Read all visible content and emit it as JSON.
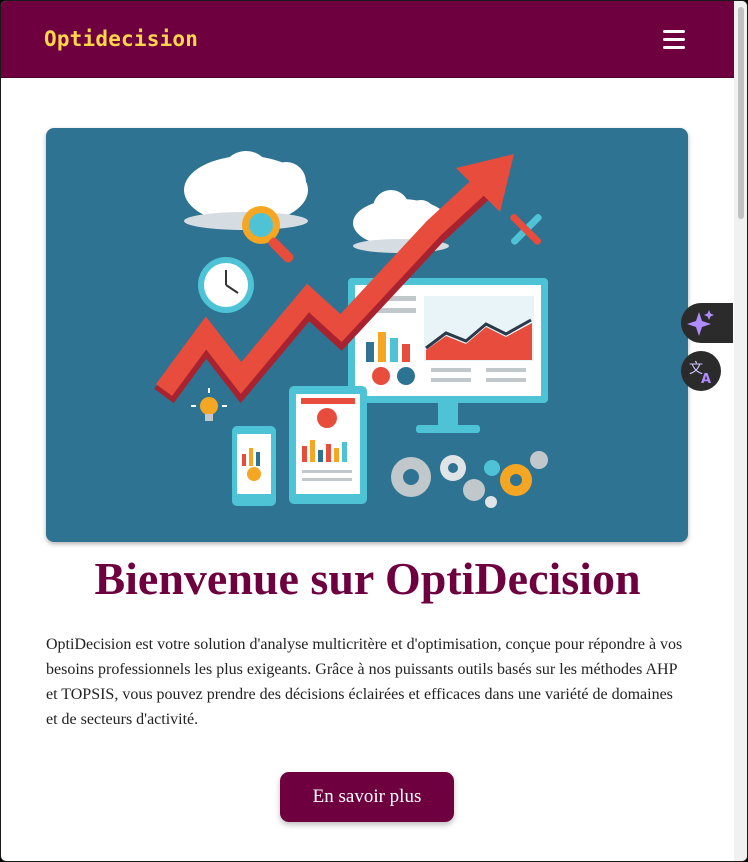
{
  "navbar": {
    "brand": "Optidecision"
  },
  "hero": {
    "image": "analytics-dashboard-illustration"
  },
  "main": {
    "title": "Bienvenue sur OptiDecision",
    "description": "OptiDecision est votre solution d'analyse multicritère et d'optimisation, conçue pour répondre à vos besoins professionnels les plus exigeants. Grâce à nos puissants outils basés sur les méthodes AHP et TOPSIS, vous pouvez prendre des décisions éclairées et efficaces dans une variété de domaines et de secteurs d'activité.",
    "cta_label": "En savoir plus"
  },
  "colors": {
    "brand": "#6e0040",
    "brand_text": "#ffd54a",
    "hero_bg": "#2e7391"
  },
  "icons": [
    "hamburger-menu-icon",
    "sparkle-icon",
    "translate-icon"
  ]
}
